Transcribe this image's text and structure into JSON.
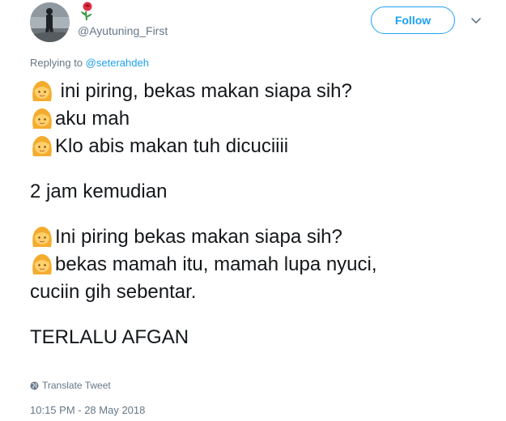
{
  "header": {
    "username": "@Ayutuning_First",
    "follow_label": "Follow",
    "display_name_icon": "rose-emoji-icon",
    "more_icon": "chevron-down-icon"
  },
  "reply": {
    "prefix": "Replying to",
    "mention": "@seterahdeh"
  },
  "tweet": {
    "lines": [
      {
        "emoji": "woman-emoji-icon",
        "text": " ini piring, bekas makan siapa sih?"
      },
      {
        "emoji": "woman-emoji-icon",
        "text": "aku mah"
      },
      {
        "emoji": "woman-emoji-icon",
        "text": "Klo abis makan tuh dicuciiii"
      },
      {
        "emoji": "",
        "text": "2 jam kemudian"
      },
      {
        "emoji": "woman-emoji-icon",
        "text": "Ini piring bekas makan siapa sih?"
      },
      {
        "emoji": "woman-emoji-icon",
        "text": "bekas mamah itu, mamah lupa nyuci,"
      },
      {
        "emoji": "",
        "text": "cuciin gih sebentar."
      },
      {
        "emoji": "",
        "text": "TERLALU AFGAN"
      }
    ]
  },
  "footer": {
    "translate_label": "Translate Tweet",
    "translate_icon": "globe-icon",
    "timestamp": "10:15 PM - 28 May 2018"
  },
  "colors": {
    "accent": "#1da1f2",
    "secondary_text": "#657786",
    "primary_text": "#14171a"
  }
}
